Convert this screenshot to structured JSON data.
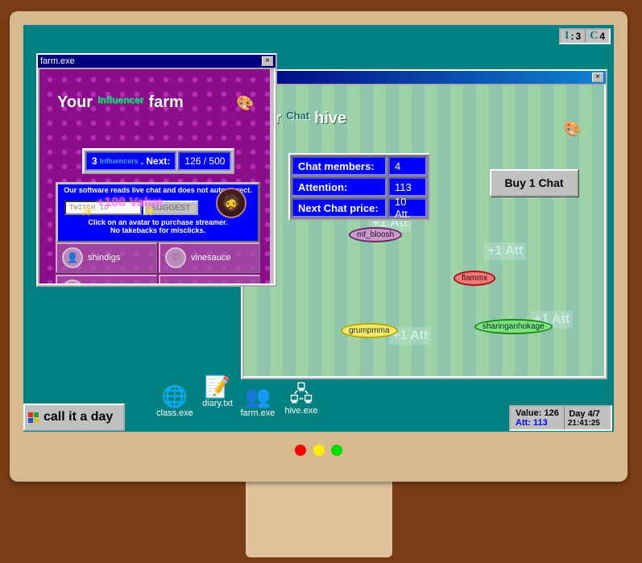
{
  "indicators": [
    {
      "letter": "I",
      "sep": ":",
      "value": "3"
    },
    {
      "letter": "C",
      "sep": "",
      "value": "4"
    }
  ],
  "hive_window": {
    "heading_prefix": "our",
    "heading_word": "Chat",
    "heading_suffix": "hive",
    "stats": [
      {
        "label": "Chat members:",
        "value": "4"
      },
      {
        "label": "Attention:",
        "value": "113"
      },
      {
        "label": "Next Chat price:",
        "value": "10 Att."
      }
    ],
    "buy_button": "Buy 1 Chat",
    "floating_att": [
      "+1 Att",
      "+1 Att",
      "+1 Att",
      "+1 Att"
    ],
    "chatters": [
      "mf_bloosh",
      "flammx",
      "grumpmma",
      "sharinganhokage"
    ],
    "close_label": "×"
  },
  "farm_window": {
    "title": "farm.exe",
    "close_label": "×",
    "heading_prefix": "Your",
    "heading_word": "Influencer",
    "heading_suffix": "farm",
    "status_count": "3",
    "status_word": "Influencers",
    "status_next_label": ". Next:",
    "status_progress": "126 / 500",
    "panel_line1": "Our software reads live chat and does not autocorrect.",
    "input_placeholder": "TWITCH ID",
    "suggest_button": "SUGGEST",
    "value_float": "+100 Value",
    "panel_line2": "Click on an avatar to purchase streamer.",
    "panel_line3": "No takebacks for misclicks.",
    "streamers": [
      "shindigs",
      "vinesauce"
    ]
  },
  "desktop_icons": [
    {
      "label": "class.exe",
      "icon": "globe-cursor-icon"
    },
    {
      "label": "diary.txt",
      "icon": "notepad-icon"
    },
    {
      "label": "farm.exe",
      "icon": "people-icon"
    },
    {
      "label": "hive.exe",
      "icon": "network-icon"
    }
  ],
  "start_button": "call it a day",
  "status_panel": {
    "value_label": "Value: 126",
    "att_label": "Att: 113",
    "day_label": "Day 4/7",
    "time": "21:41:25"
  },
  "colors": {
    "desktop": "#008080",
    "window_title": "#000080",
    "panel_blue": "#0000ff",
    "farm_bg": "#8a0d8a",
    "led_red": "#ff0000",
    "led_yellow": "#ffee00",
    "led_green": "#00dd00"
  }
}
